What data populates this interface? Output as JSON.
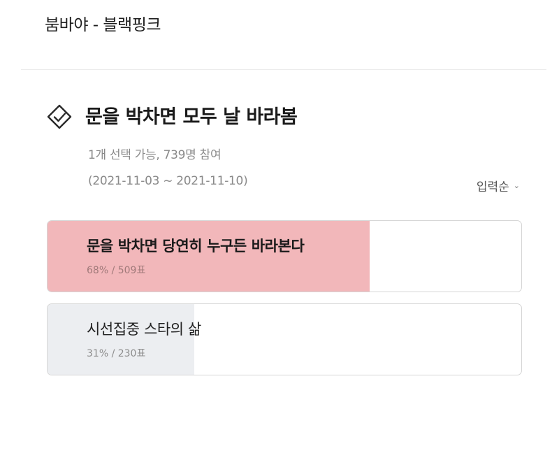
{
  "header": {
    "title": "붐바야 - 블랙핑크"
  },
  "poll": {
    "icon": "check-diamond-icon",
    "title": "문을 박차면 모두 날 바라봄",
    "meta": "1개 선택 가능, 739명 참여",
    "period": "(2021-11-03 ~ 2021-11-10)",
    "sort_label": "입력순",
    "sort_icon": "chevron-down-icon",
    "options": [
      {
        "label": "문을 박차면 당연히 누구든 바라본다",
        "result": "68% / 509표",
        "percent": 68,
        "votes": 509,
        "fill_color": "#f2b7ba"
      },
      {
        "label": "시선집중 스타의 삶",
        "result": "31% / 230표",
        "percent": 31,
        "votes": 230,
        "fill_color": "#eceef1"
      }
    ]
  }
}
